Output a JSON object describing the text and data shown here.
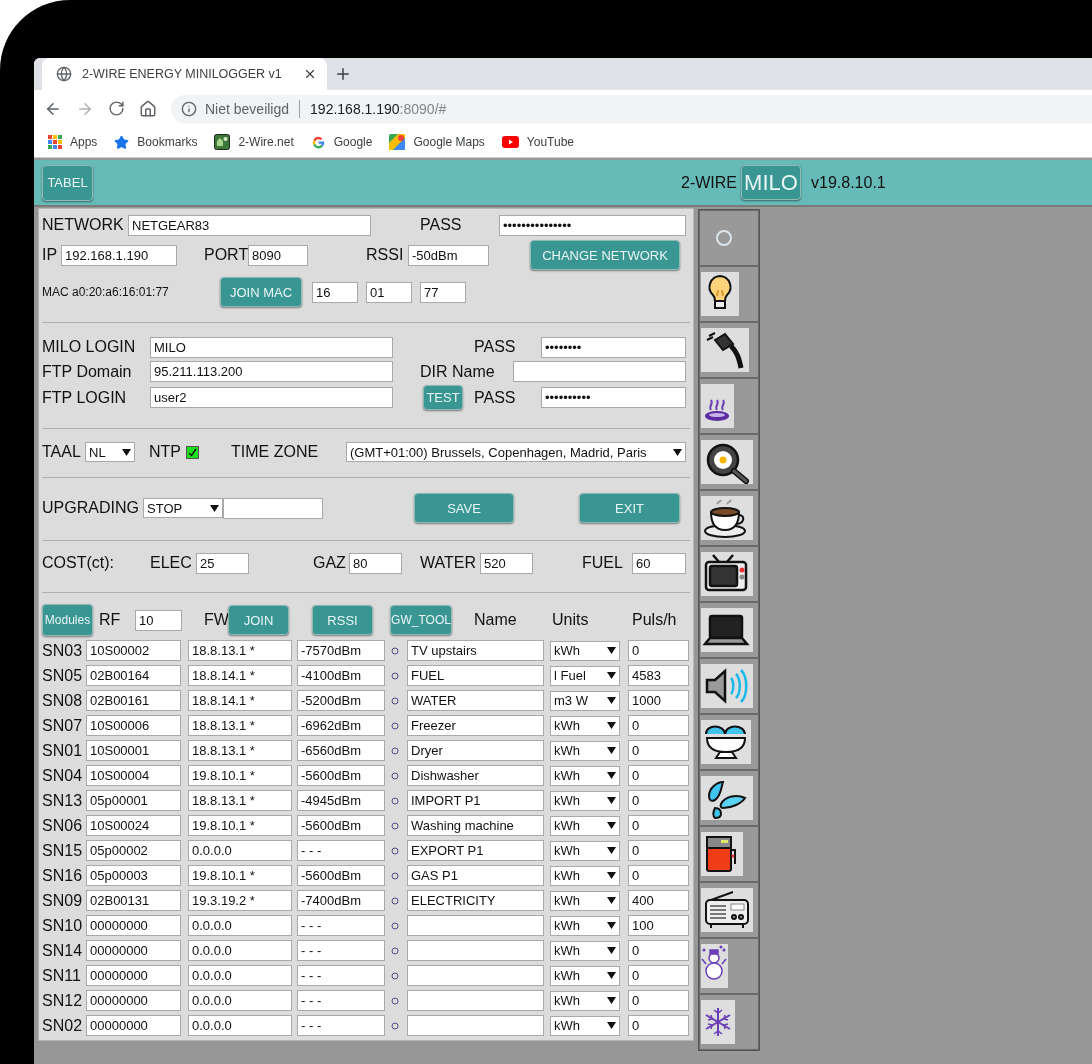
{
  "browser": {
    "tab_title": "2-WIRE ENERGY MINILOGGER v1",
    "address": {
      "security": "Niet beveiligd",
      "host": "192.168.1.190",
      "path": ":8090/#"
    },
    "bookmarks": [
      {
        "kind": "apps",
        "label": "Apps"
      },
      {
        "kind": "star",
        "label": "Bookmarks"
      },
      {
        "kind": "site",
        "label": "2-Wire.net"
      },
      {
        "kind": "google",
        "label": "Google"
      },
      {
        "kind": "maps",
        "label": "Google Maps"
      },
      {
        "kind": "video",
        "label": "YouTube"
      }
    ]
  },
  "header": {
    "tabel_button": "TABEL",
    "brand": "2-WIRE",
    "milo_button": "MILO",
    "version": "v19.8.10.1"
  },
  "network": {
    "network_label": "NETWORK",
    "network": "NETGEAR83",
    "pass_label": "PASS",
    "pass": "•••••••••••••••",
    "ip_label": "IP",
    "ip": "192.168.1.190",
    "port_label": "PORT",
    "port": "8090",
    "rssi_label": "RSSI",
    "rssi": "-50dBm",
    "change_button": "CHANGE NETWORK",
    "mac": "MAC a0:20:a6:16:01:77",
    "join_mac_button": "JOIN MAC",
    "mac_parts": [
      "16",
      "01",
      "77"
    ]
  },
  "login": {
    "milo_login_label": "MILO LOGIN",
    "milo_login": "MILO",
    "pass_label": "PASS",
    "pass": "••••••••",
    "ftp_domain_label": "FTP Domain",
    "ftp_domain": "95.211.113.200",
    "dir_label": "DIR Name",
    "ftp_login_label": "FTP LOGIN",
    "ftp_login": "user2",
    "test_button": "TEST",
    "ftp_pass_label": "PASS",
    "ftp_pass": "••••••••••"
  },
  "locale": {
    "taal_label": "TAAL",
    "taal": "NL",
    "ntp_label": "NTP",
    "ntp_checked": true,
    "timezone_label": "TIME ZONE",
    "timezone": "(GMT+01:00) Brussels, Copenhagen, Madrid, Paris"
  },
  "upgrade": {
    "label": "UPGRADING",
    "mode": "STOP",
    "save_button": "SAVE",
    "exit_button": "EXIT"
  },
  "cost": {
    "label": "COST(ct):",
    "items": [
      {
        "label": "ELEC",
        "value": "25"
      },
      {
        "label": "GAZ",
        "value": "80"
      },
      {
        "label": "WATER",
        "value": "520"
      },
      {
        "label": "FUEL",
        "value": "60"
      }
    ]
  },
  "modules": {
    "modules_button": "Modules",
    "rf_label": "RF",
    "rf": "10",
    "fw_label": "FW",
    "join_button": "JOIN",
    "rssi_button": "RSSI",
    "gw_tool_button": "GW_TOOL",
    "columns": [
      "Name",
      "Units",
      "Puls/h"
    ],
    "rows": [
      {
        "sn": "SN03",
        "id": "10S00002",
        "fw": "18.8.13.1 *",
        "rssi": "-7570dBm",
        "name": "TV upstairs",
        "units": "kWh",
        "puls": "0"
      },
      {
        "sn": "SN05",
        "id": "02B00164",
        "fw": "18.8.14.1 *",
        "rssi": "-4100dBm",
        "name": "FUEL",
        "units": "l Fuel",
        "puls": "4583"
      },
      {
        "sn": "SN08",
        "id": "02B00161",
        "fw": "18.8.14.1 *",
        "rssi": "-5200dBm",
        "name": "WATER",
        "units": "m3 W",
        "puls": "1000"
      },
      {
        "sn": "SN07",
        "id": "10S00006",
        "fw": "18.8.13.1 *",
        "rssi": "-6962dBm",
        "name": "Freezer",
        "units": "kWh",
        "puls": "0"
      },
      {
        "sn": "SN01",
        "id": "10S00001",
        "fw": "18.8.13.1 *",
        "rssi": "-6560dBm",
        "name": "Dryer",
        "units": "kWh",
        "puls": "0"
      },
      {
        "sn": "SN04",
        "id": "10S00004",
        "fw": "19.8.10.1 *",
        "rssi": "-5600dBm",
        "name": "Dishwasher",
        "units": "kWh",
        "puls": "0"
      },
      {
        "sn": "SN13",
        "id": "05p00001",
        "fw": "18.8.13.1 *",
        "rssi": "-4945dBm",
        "name": "IMPORT P1",
        "units": "kWh",
        "puls": "0"
      },
      {
        "sn": "SN06",
        "id": "10S00024",
        "fw": "19.8.10.1 *",
        "rssi": "-5600dBm",
        "name": "Washing machine",
        "units": "kWh",
        "puls": "0"
      },
      {
        "sn": "SN15",
        "id": "05p00002",
        "fw": "0.0.0.0",
        "rssi": "- - -",
        "name": "EXPORT P1",
        "units": "kWh",
        "puls": "0"
      },
      {
        "sn": "SN16",
        "id": "05p00003",
        "fw": "19.8.10.1 *",
        "rssi": "-5600dBm",
        "name": "GAS P1",
        "units": "kWh",
        "puls": "0"
      },
      {
        "sn": "SN09",
        "id": "02B00131",
        "fw": "19.3.19.2 *",
        "rssi": "-7400dBm",
        "name": "ELECTRICITY",
        "units": "kWh",
        "puls": "400"
      },
      {
        "sn": "SN10",
        "id": "00000000",
        "fw": "0.0.0.0",
        "rssi": "- - -",
        "units": "kWh",
        "puls": "100"
      },
      {
        "sn": "SN14",
        "id": "00000000",
        "fw": "0.0.0.0",
        "rssi": "- - -",
        "units": "kWh",
        "puls": "0"
      },
      {
        "sn": "SN11",
        "id": "00000000",
        "fw": "0.0.0.0",
        "rssi": "- - -",
        "units": "kWh",
        "puls": "0"
      },
      {
        "sn": "SN12",
        "id": "00000000",
        "fw": "0.0.0.0",
        "rssi": "- - -",
        "units": "kWh",
        "puls": "0"
      },
      {
        "sn": "SN02",
        "id": "00000000",
        "fw": "0.0.0.0",
        "rssi": "- - -",
        "units": "kWh",
        "puls": "0"
      }
    ]
  }
}
